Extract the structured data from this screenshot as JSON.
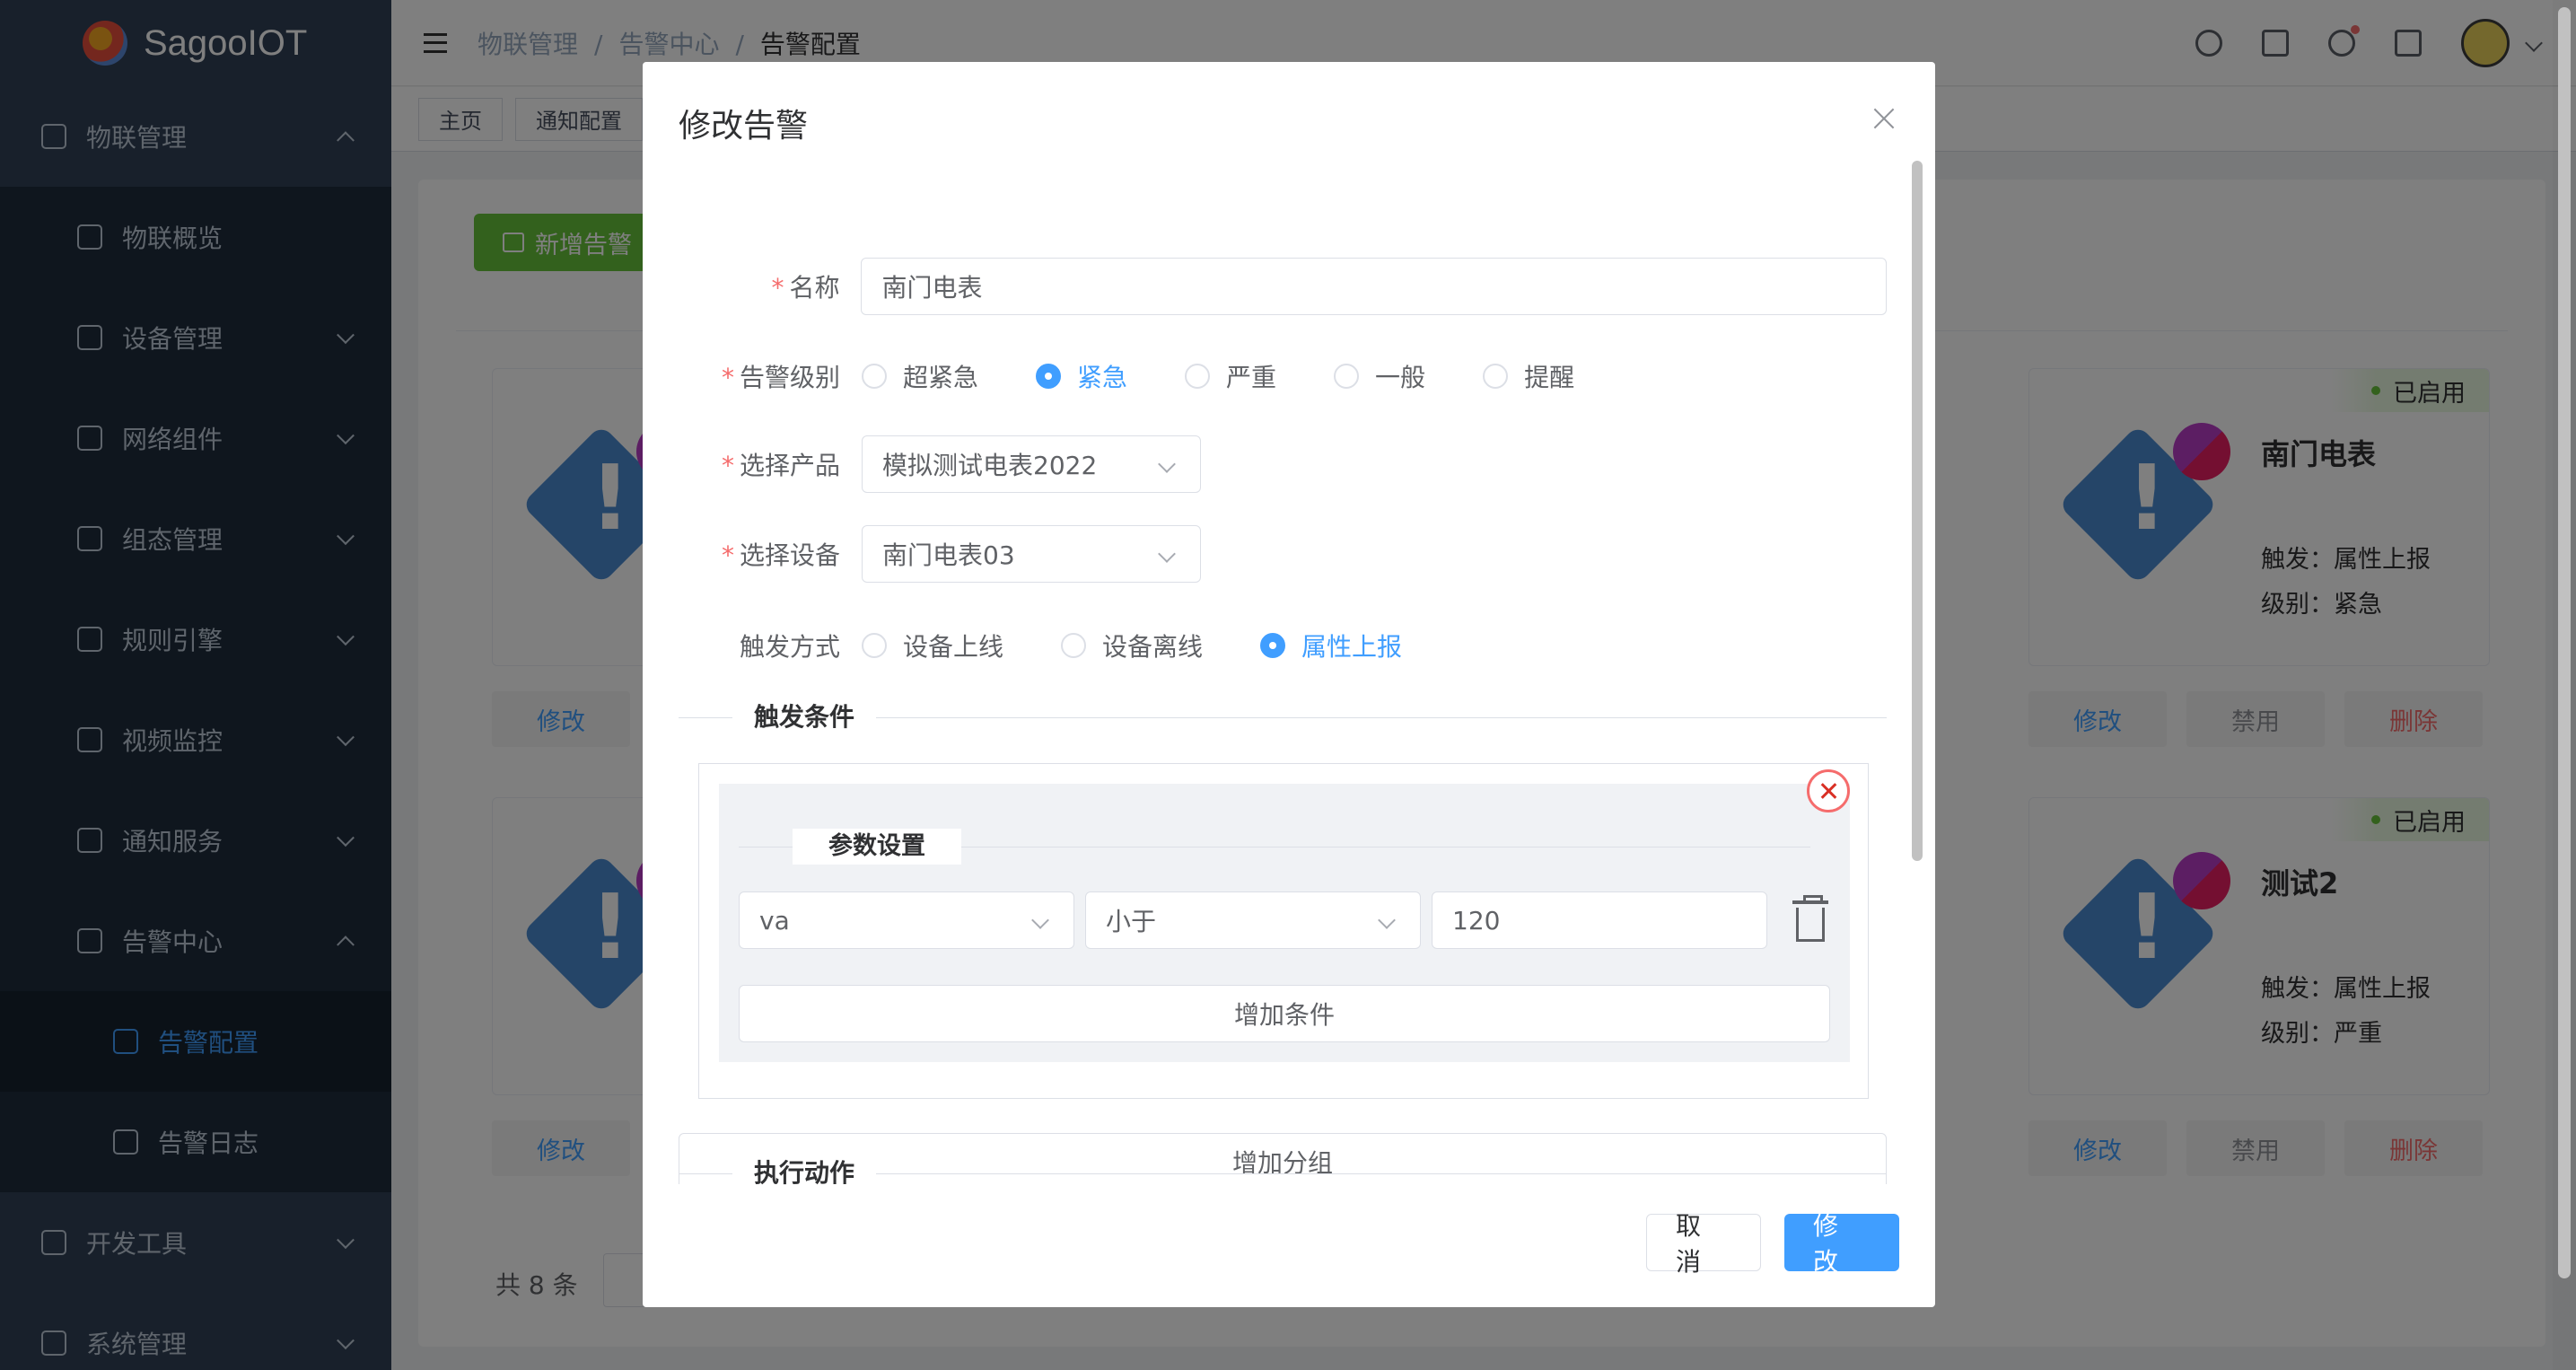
{
  "app": {
    "logo_text": "SagooIOT"
  },
  "sidebar": {
    "items": [
      {
        "label": "物联管理",
        "level": 1,
        "chevron": "up",
        "icon": "cloud-icon"
      },
      {
        "label": "物联概览",
        "level": 2,
        "icon": "monitor-icon"
      },
      {
        "label": "设备管理",
        "level": 2,
        "chevron": "down",
        "icon": "devices-icon"
      },
      {
        "label": "网络组件",
        "level": 2,
        "chevron": "down",
        "icon": "network-icon"
      },
      {
        "label": "组态管理",
        "level": 2,
        "chevron": "down",
        "icon": "config-icon"
      },
      {
        "label": "规则引擎",
        "level": 2,
        "chevron": "down",
        "icon": "rules-icon"
      },
      {
        "label": "视频监控",
        "level": 2,
        "chevron": "down",
        "icon": "video-icon"
      },
      {
        "label": "通知服务",
        "level": 2,
        "chevron": "down",
        "icon": "broadcast-icon"
      },
      {
        "label": "告警中心",
        "level": 2,
        "chevron": "up",
        "icon": "speaker-icon"
      },
      {
        "label": "告警配置",
        "level": 3,
        "active": true,
        "icon": "monitor-icon"
      },
      {
        "label": "告警日志",
        "level": 3,
        "icon": "document-icon"
      },
      {
        "label": "开发工具",
        "level": 1,
        "chevron": "down",
        "icon": "laptop-icon"
      },
      {
        "label": "系统管理",
        "level": 1,
        "chevron": "down",
        "icon": "gear-icon"
      }
    ]
  },
  "breadcrumb": {
    "items": [
      "物联管理",
      "告警中心",
      "告警配置"
    ],
    "separator": "/"
  },
  "tags": [
    "主页",
    "通知配置"
  ],
  "page": {
    "add_button": "新增告警",
    "cards_right": [
      {
        "status": "已启用",
        "name": "南门电表",
        "trigger": "触发：属性上报",
        "level": "级别：紧急"
      },
      {
        "status": "已启用",
        "name": "测试2",
        "trigger": "触发：属性上报",
        "level": "级别：严重"
      }
    ],
    "card_actions": {
      "edit": "修改",
      "disable": "禁用",
      "delete": "删除"
    },
    "partial_status": "用",
    "partial_delete": "除",
    "total": "共 8 条"
  },
  "modal": {
    "title": "修改告警",
    "fields": {
      "name": {
        "label": "名称",
        "value": "南门电表"
      },
      "level": {
        "label": "告警级别",
        "options": [
          "超紧急",
          "紧急",
          "严重",
          "一般",
          "提醒"
        ],
        "selected": "紧急"
      },
      "product": {
        "label": "选择产品",
        "value": "模拟测试电表2022"
      },
      "device": {
        "label": "选择设备",
        "value": "南门电表03"
      },
      "trigger": {
        "label": "触发方式",
        "options": [
          "设备上线",
          "设备离线",
          "属性上报"
        ],
        "selected": "属性上报"
      }
    },
    "trigger_section": "触发条件",
    "param_section": "参数设置",
    "condition": {
      "field": "va",
      "operator": "小于",
      "value": "120"
    },
    "add_condition": "增加条件",
    "add_group": "增加分组",
    "action_section": "执行动作",
    "cancel": "取 消",
    "submit": "修 改"
  }
}
